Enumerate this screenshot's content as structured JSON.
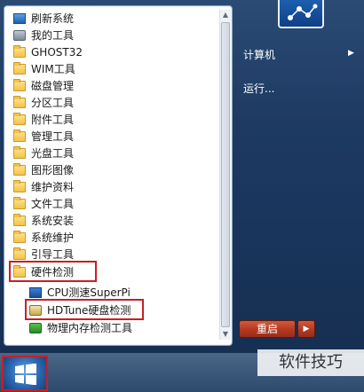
{
  "start_menu": {
    "programs": [
      {
        "label": "刷新系统",
        "icon": "refresh-system-icon",
        "kind": "app"
      },
      {
        "label": "我的工具",
        "icon": "tools-icon",
        "kind": "app"
      },
      {
        "label": "GHOST32",
        "icon": "folder-icon",
        "kind": "folder"
      },
      {
        "label": "WIM工具",
        "icon": "folder-icon",
        "kind": "folder"
      },
      {
        "label": "磁盘管理",
        "icon": "folder-icon",
        "kind": "folder"
      },
      {
        "label": "分区工具",
        "icon": "folder-icon",
        "kind": "folder"
      },
      {
        "label": "附件工具",
        "icon": "folder-icon",
        "kind": "folder"
      },
      {
        "label": "管理工具",
        "icon": "folder-icon",
        "kind": "folder"
      },
      {
        "label": "光盘工具",
        "icon": "folder-icon",
        "kind": "folder"
      },
      {
        "label": "图形图像",
        "icon": "folder-icon",
        "kind": "folder"
      },
      {
        "label": "维护资料",
        "icon": "folder-icon",
        "kind": "folder"
      },
      {
        "label": "文件工具",
        "icon": "folder-icon",
        "kind": "folder"
      },
      {
        "label": "系统安装",
        "icon": "folder-icon",
        "kind": "folder"
      },
      {
        "label": "系统维护",
        "icon": "folder-icon",
        "kind": "folder"
      },
      {
        "label": "引导工具",
        "icon": "folder-icon",
        "kind": "folder"
      },
      {
        "label": "硬件检测",
        "icon": "folder-icon",
        "kind": "folder",
        "highlighted": true
      }
    ],
    "hardware_subitems": [
      {
        "label": "CPU测速SuperPi",
        "icon": "superpi-icon"
      },
      {
        "label": "HDTune硬盘检测",
        "icon": "hdtune-icon",
        "highlighted": true
      },
      {
        "label": "物理内存检测工具",
        "icon": "memory-check-icon"
      }
    ],
    "right_pane": {
      "computer_label": "计算机",
      "run_label": "运行...",
      "shutdown_label": "重启"
    }
  },
  "watermark": "软件技巧",
  "colors": {
    "highlight_border": "#c81f25",
    "menu_frame": "#1d3a63",
    "shutdown": "#b53a22"
  }
}
